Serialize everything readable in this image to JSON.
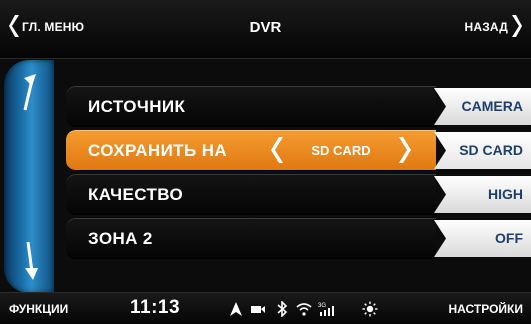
{
  "header": {
    "back_menu_label": "ГЛ. МЕНЮ",
    "title": "DVR",
    "back_label": "НАЗАД"
  },
  "rows": [
    {
      "label": "ИСТОЧНИК",
      "value": "CAMERA"
    },
    {
      "label": "СОХРАНИТЬ НА",
      "value": "SD CARD",
      "selector_value": "SD CARD",
      "active": true
    },
    {
      "label": "КАЧЕСТВО",
      "value": "HIGH"
    },
    {
      "label": "ЗОНА 2",
      "value": "OFF"
    }
  ],
  "footer": {
    "functions_label": "ФУНКЦИИ",
    "time": "11:13",
    "settings_label": "НАСТРОЙКИ",
    "status_icons": [
      "navigation-icon",
      "camera-icon",
      "bluetooth-icon",
      "wifi-icon",
      "3g-signal-icon",
      "brightness-icon"
    ]
  },
  "colors": {
    "active_row": "#f0902a",
    "value_text": "#1d3f6e",
    "rail": "#1a6ea8"
  }
}
